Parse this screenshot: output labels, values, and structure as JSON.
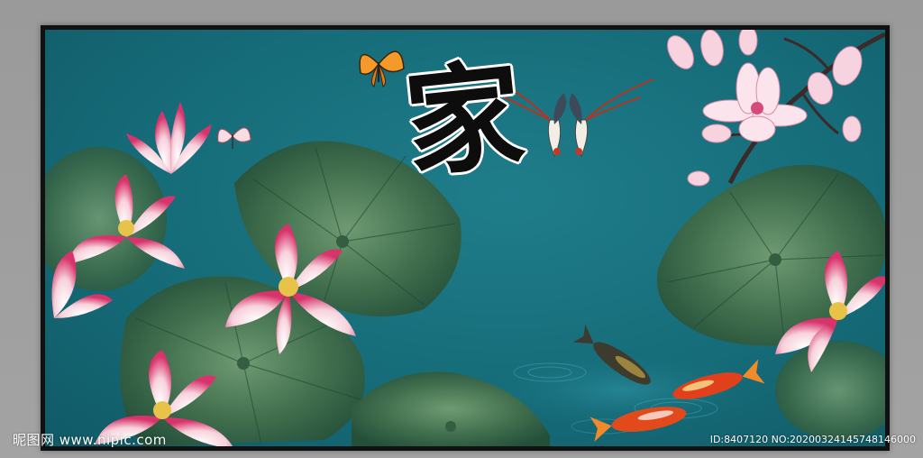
{
  "painting": {
    "calligraphy_character": "家",
    "background_color": "#166c79",
    "frame_color": "#111111",
    "elements": [
      "lotus-flowers",
      "lotus-leaves",
      "magnolia-branch",
      "butterflies",
      "swallows",
      "koi-fish",
      "water-ripples"
    ]
  },
  "watermark": {
    "site_text": "昵图网 www.nipic.com",
    "id_text": "ID:8407120 NO:20200324145748146000"
  }
}
